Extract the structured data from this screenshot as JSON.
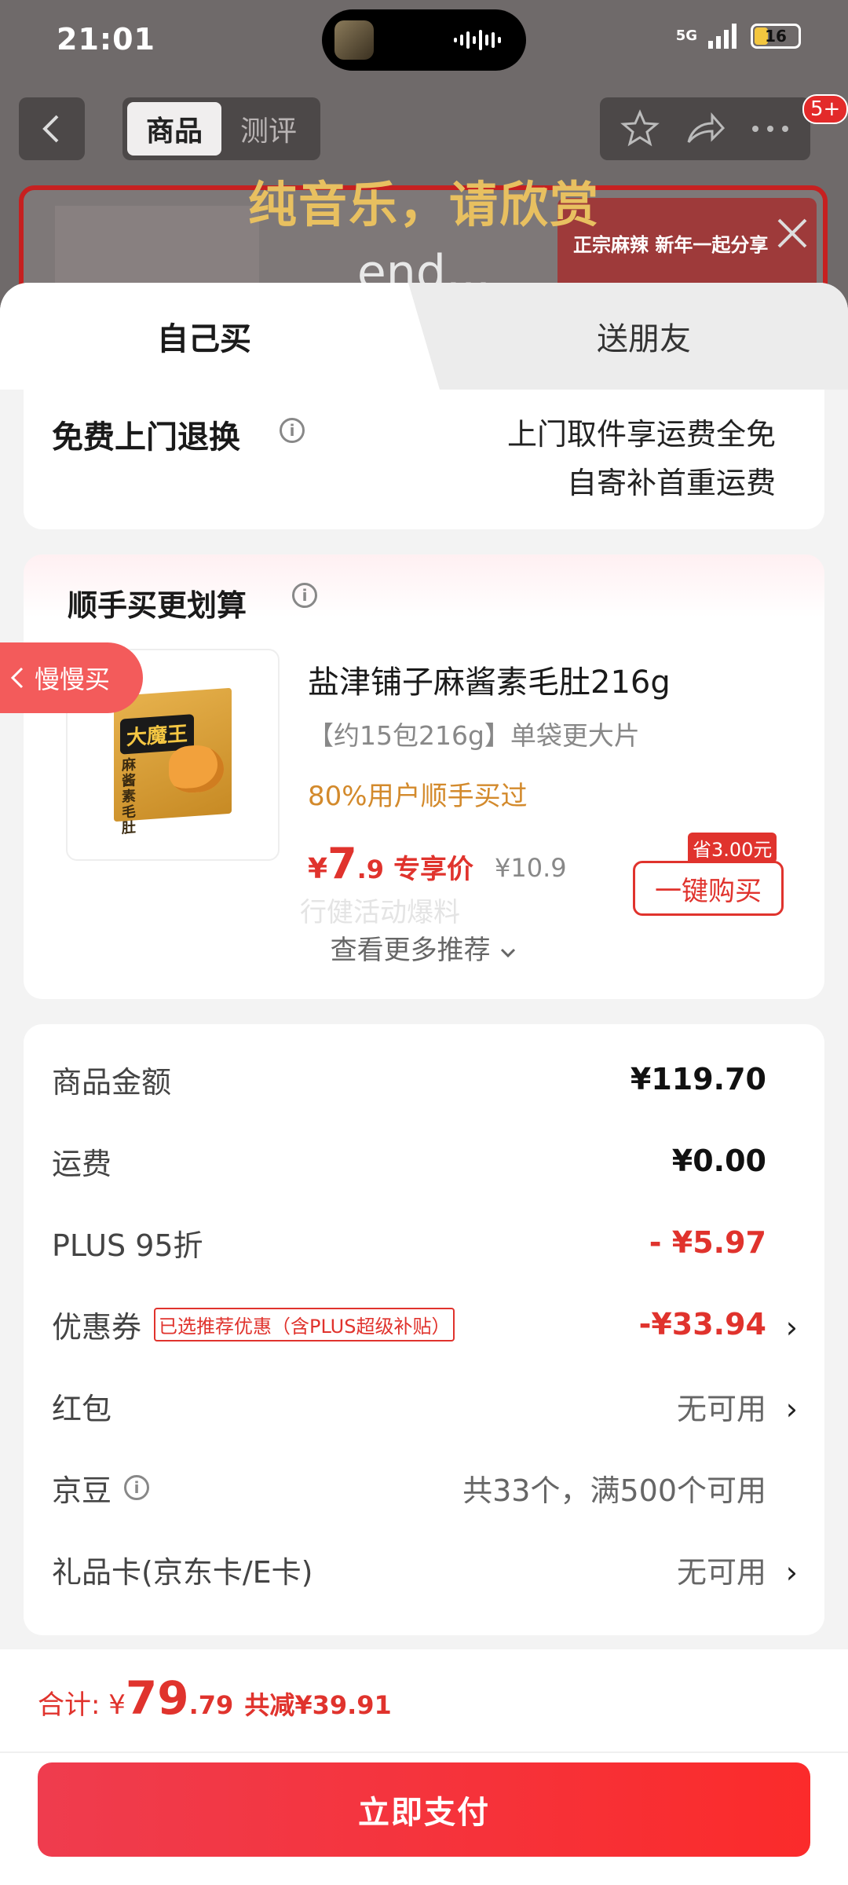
{
  "status": {
    "time": "21:01",
    "network": "5G",
    "battery": "16"
  },
  "nav": {
    "tab_product": "商品",
    "tab_review": "测评",
    "notif_badge": "5+"
  },
  "overlay": {
    "title": "纯音乐，请欣赏",
    "end_text": "end...",
    "banner_right": "正宗麻辣 新年一起分享"
  },
  "tabs": {
    "self": "自己买",
    "friend": "送朋友"
  },
  "return": {
    "title": "免费上门退换",
    "line1": "上门取件享运费全免",
    "line2": "自寄补首重运费"
  },
  "recommend": {
    "title": "顺手买更划算",
    "side_tab": "慢慢买",
    "product": {
      "box_logo": "大魔王",
      "box_label": "麻酱素毛肚",
      "name": "盐津铺子麻酱素毛肚216g",
      "spec": "【约15包216g】单袋更大片",
      "stat": "80%用户顺手买过",
      "price_yen": "¥",
      "price_int": "7",
      "price_dec": ".9",
      "price_tag": "专享价",
      "orig_price": "¥10.9",
      "save_badge": "省3.00元",
      "buy_label": "一键购买"
    },
    "ghost_text": "行健活动爆料",
    "more_label": "查看更多推荐"
  },
  "summary": {
    "goods_label": "商品金额",
    "goods_value": "¥119.70",
    "shipping_label": "运费",
    "shipping_value": "¥0.00",
    "plus_label": "PLUS 95折",
    "plus_value": "- ¥5.97",
    "coupon_label": "优惠券",
    "coupon_tag": "已选推荐优惠（含PLUS超级补贴）",
    "coupon_value": "-¥33.94",
    "redpacket_label": "红包",
    "redpacket_value": "无可用",
    "jingdou_label": "京豆",
    "jingdou_value": "共33个，满500个可用",
    "giftcard_label": "礼品卡(京东卡/E卡)",
    "giftcard_value": "无可用"
  },
  "footer": {
    "total_label": "合计: ¥",
    "total_int": "79",
    "total_dec": ".79",
    "total_save": "共减¥39.91",
    "pay_label": "立即支付"
  },
  "colors": {
    "accent": "#e0332d",
    "pay_button": "#fb2b2b",
    "stat": "#d38a2c"
  }
}
